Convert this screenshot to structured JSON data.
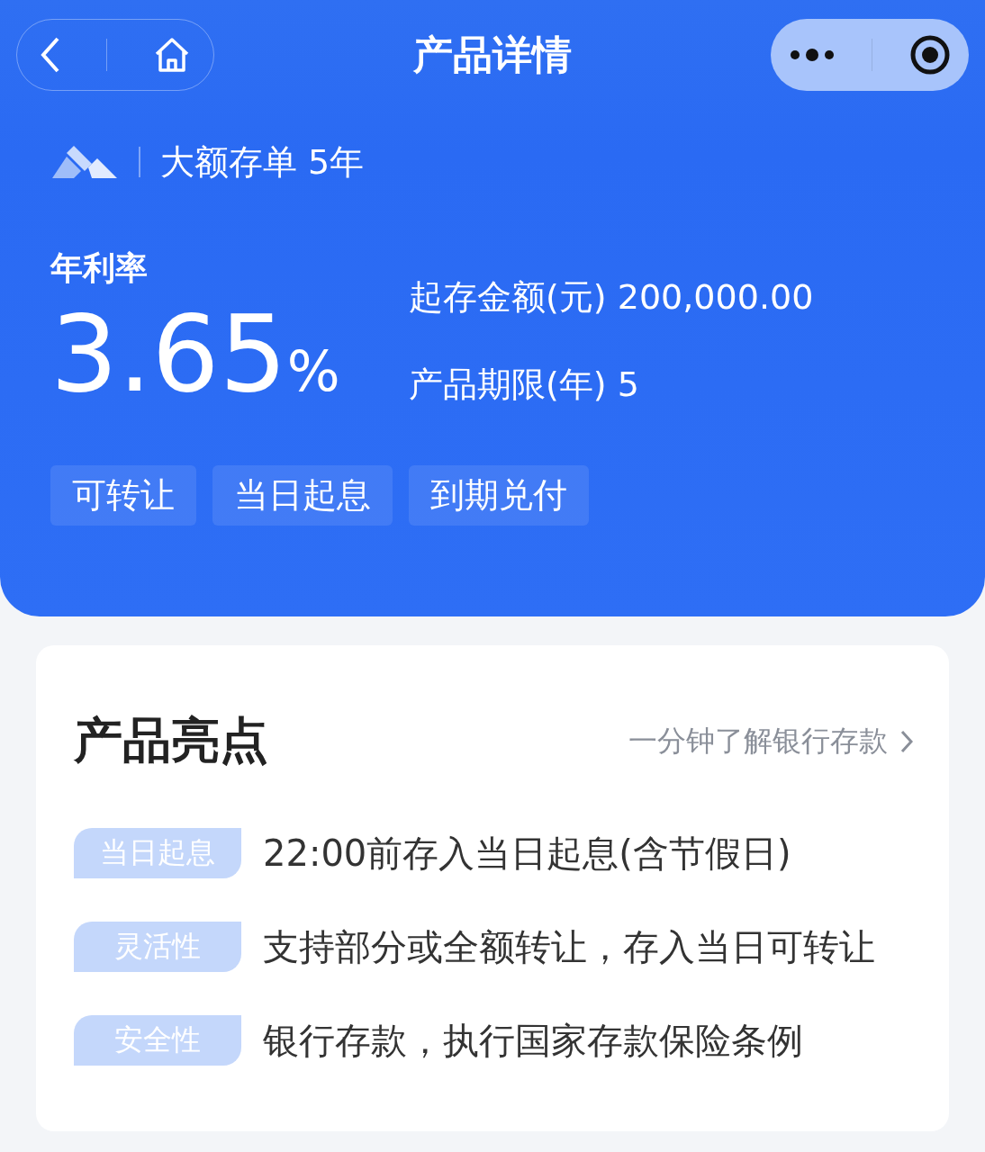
{
  "nav": {
    "title": "产品详情"
  },
  "product": {
    "name": "大额存单 5年"
  },
  "rate": {
    "label": "年利率",
    "value": "3.65",
    "unit": "%"
  },
  "facts": [
    {
      "label": "起存金额(元)",
      "value": "200,000.00"
    },
    {
      "label": "产品期限(年)",
      "value": "5"
    }
  ],
  "tags": [
    "可转让",
    "当日起息",
    "到期兑付"
  ],
  "highlights": {
    "title": "产品亮点",
    "link": "一分钟了解银行存款",
    "items": [
      {
        "tag": "当日起息",
        "text": "22:00前存入当日起息(含节假日)"
      },
      {
        "tag": "灵活性",
        "text": "支持部分或全额转让，存入当日可转让"
      },
      {
        "tag": "安全性",
        "text": "银行存款，执行国家存款保险条例"
      }
    ]
  }
}
